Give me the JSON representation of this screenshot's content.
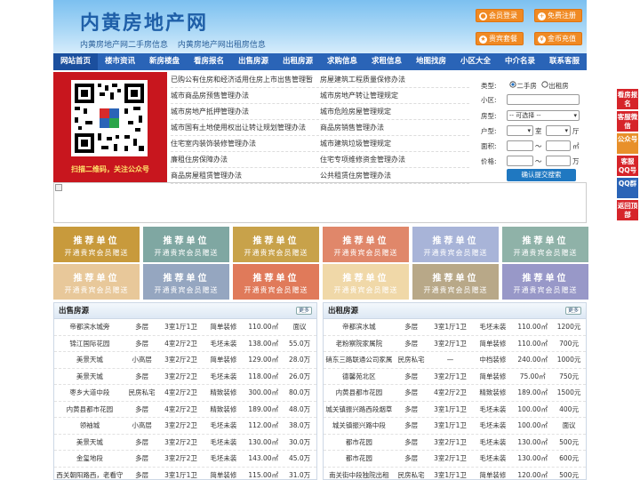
{
  "header": {
    "title": "内黄房地产网",
    "sub": [
      "内黄房地产网二手房信息",
      "内黄房地产网出租房信息"
    ],
    "buttons": [
      "会员登录",
      "免费注册",
      "贵宾套餐",
      "金币充值"
    ]
  },
  "nav": [
    "网站首页",
    "楼市资讯",
    "新房楼盘",
    "看房报名",
    "出售房源",
    "出租房源",
    "求购信息",
    "求租信息",
    "地图找房",
    "小区大全",
    "中介名录",
    "联系客服"
  ],
  "qr": {
    "caption": "扫描二维码，关注公众号"
  },
  "links": [
    [
      "已购公有住房和经济适用住房上市出售管理暂",
      "房屋建筑工程质量保修办法"
    ],
    [
      "城市商品房预售管理办法",
      "城市房地产转让管理规定"
    ],
    [
      "城市房地产抵押管理办法",
      "城市危险房屋管理规定"
    ],
    [
      "城市国有土地使用权出让转让规划管理办法",
      "商品房销售管理办法"
    ],
    [
      "住宅室内装饰装修管理办法",
      "城市建筑垃圾管理规定"
    ],
    [
      "廉租住房保障办法",
      "住宅专项维修资金管理办法"
    ],
    [
      "商品房屋租赁管理办法",
      "公共租赁住房管理办法"
    ]
  ],
  "search": {
    "type_label": "类型:",
    "type_options": [
      "二手房",
      "出租房"
    ],
    "xiaoqu_label": "小区:",
    "fangxing_label": "房型:",
    "fangxing_value": "-- 可选择 --",
    "huxing_label": "户型:",
    "shi": "室",
    "ting": "厅",
    "area_label": "面积:",
    "area_unit": "㎡",
    "price_label": "价格:",
    "price_unit": "万",
    "tilde": "〜",
    "submit": "确认提交搜索"
  },
  "ads": {
    "line1": "推荐单位",
    "line2": "开通贵宾会员赠送",
    "colors": [
      "#c89a3c",
      "#7fa7a2",
      "#c8a24a",
      "#e0876a",
      "#a8b4d8",
      "#8fb2a8",
      "#e8c89a",
      "#95a6c0",
      "#e07a5a",
      "#f0d8a8",
      "#b8a888",
      "#9898c8"
    ]
  },
  "listing_sale": {
    "title": "出售房源",
    "more": "更多",
    "rows": [
      [
        "帝都滨水城旁",
        "多层",
        "3室1厅1卫",
        "简单装修",
        "110.00㎡",
        "面议"
      ],
      [
        "锦江国际花园",
        "多层",
        "4室2厅2卫",
        "毛坯未装",
        "138.00㎡",
        "55.0万"
      ],
      [
        "美景天城",
        "小高层",
        "3室2厅2卫",
        "简单装修",
        "129.00㎡",
        "28.0万"
      ],
      [
        "美景天城",
        "多层",
        "3室2厅2卫",
        "毛坯未装",
        "118.00㎡",
        "26.0万"
      ],
      [
        "枣乡大道中段",
        "民房私宅",
        "4室2厅2卫",
        "精致装修",
        "300.00㎡",
        "80.0万"
      ],
      [
        "内黄县都市花园",
        "多层",
        "4室2厅2卫",
        "精致装修",
        "189.00㎡",
        "48.0万"
      ],
      [
        "领袖城",
        "小高层",
        "3室2厅2卫",
        "毛坯未装",
        "112.00㎡",
        "38.0万"
      ],
      [
        "美景天城",
        "多层",
        "3室2厅2卫",
        "毛坯未装",
        "130.00㎡",
        "30.0万"
      ],
      [
        "金玺地段",
        "多层",
        "3室2厅2卫",
        "毛坯未装",
        "143.00㎡",
        "45.0万"
      ],
      [
        "西关朝阳路西，老看守",
        "多层",
        "3室1厅1卫",
        "简单装修",
        "115.00㎡",
        "31.0万"
      ]
    ]
  },
  "listing_rent": {
    "title": "出租房源",
    "more": "更多",
    "rows": [
      [
        "帝都滨水城",
        "多层",
        "3室1厅1卫",
        "毛坯未装",
        "110.00㎡",
        "1200元"
      ],
      [
        "老粉察院家属院",
        "多层",
        "3室2厅1卫",
        "简单装修",
        "110.00㎡",
        "700元"
      ],
      [
        "硝东三路联通公司家属",
        "民房私宅",
        "—",
        "中档装修",
        "240.00㎡",
        "1000元"
      ],
      [
        "德馨苑北区",
        "多层",
        "3室2厅1卫",
        "简单装修",
        "75.00㎡",
        "750元"
      ],
      [
        "内黄县都市花园",
        "多层",
        "4室2厅2卫",
        "精致装修",
        "189.00㎡",
        "1500元"
      ],
      [
        "城关镇振兴路西段烟草",
        "多层",
        "3室1厅1卫",
        "毛坯未装",
        "100.00㎡",
        "400元"
      ],
      [
        "城关镇振兴路中段",
        "多层",
        "3室1厅1卫",
        "毛坯未装",
        "100.00㎡",
        "面议"
      ],
      [
        "都市花园",
        "多层",
        "3室2厅1卫",
        "毛坯未装",
        "130.00㎡",
        "500元"
      ],
      [
        "都市花园",
        "多层",
        "3室2厅1卫",
        "毛坯未装",
        "130.00㎡",
        "600元"
      ],
      [
        "南关街中段独院出租",
        "民房私宅",
        "3室1厅1卫",
        "简单装修",
        "120.00㎡",
        "500元"
      ]
    ]
  },
  "sidebar": [
    "看房报名",
    "客服微信",
    "公众号",
    "客服QQ号",
    "QQ群",
    "返回顶部"
  ],
  "sidebar_colors": [
    "#d6242a",
    "#d6242a",
    "#e8902a",
    "#d6242a",
    "#2a64b7",
    "#d6242a"
  ]
}
